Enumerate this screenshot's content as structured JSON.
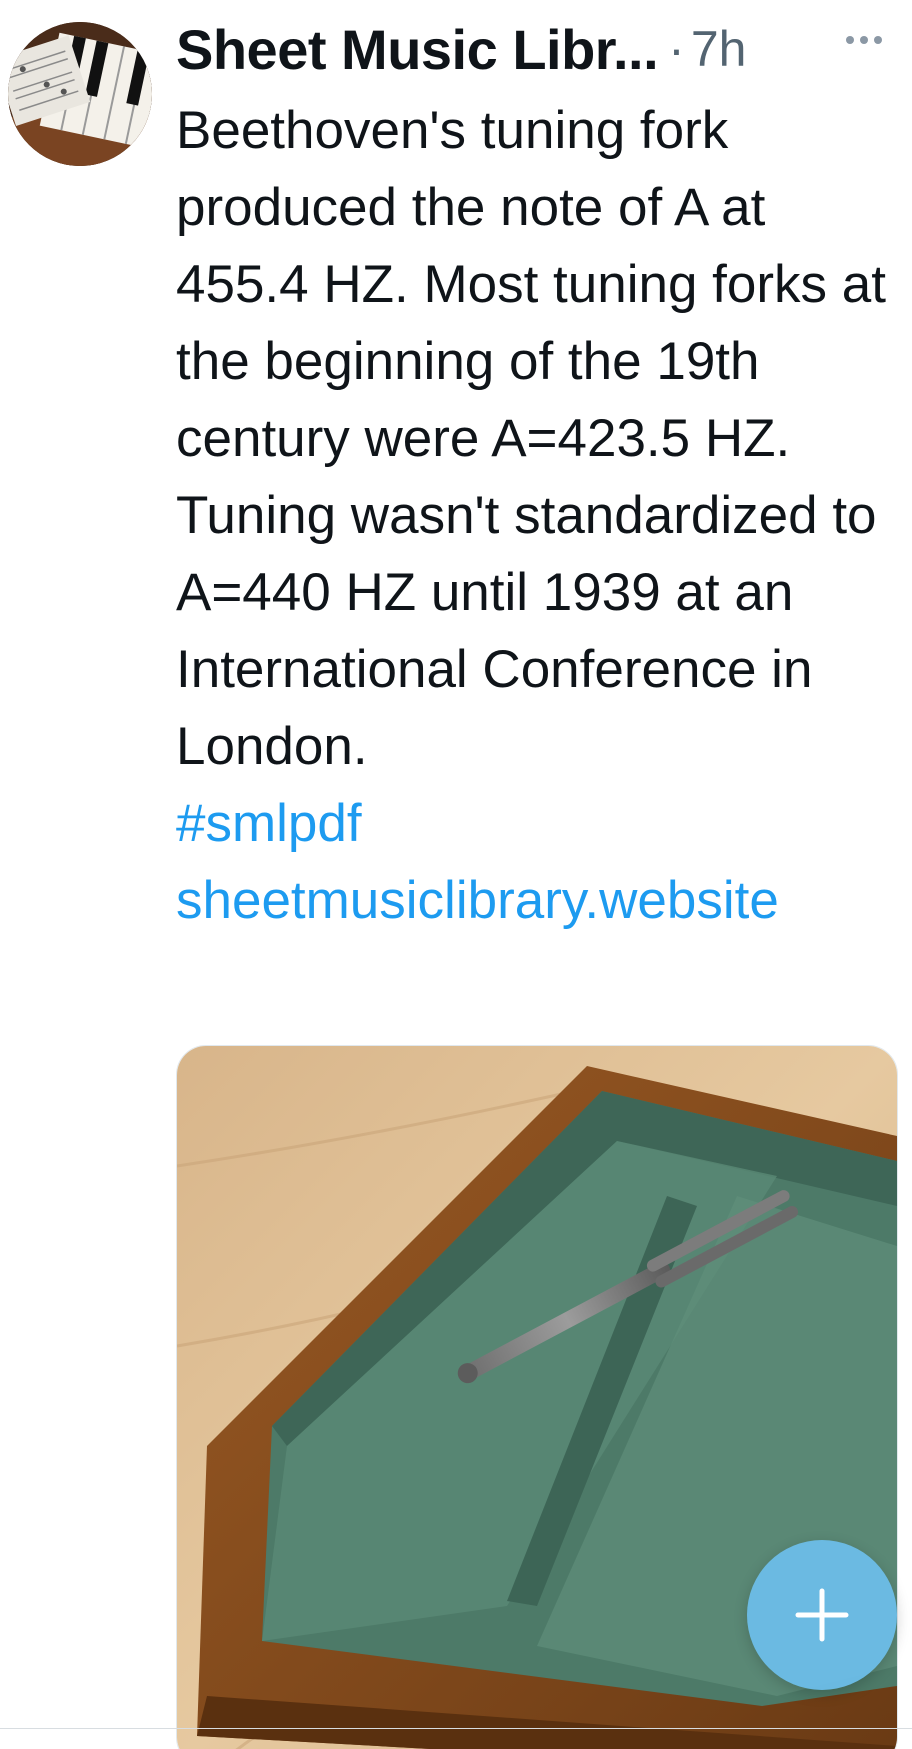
{
  "tweet": {
    "author_name": "Sheet Music Libr...",
    "separator": "·",
    "timestamp": "7h",
    "body_text": "Beethoven's tuning fork produced the note of A at 455.4 HZ. Most tuning forks at the beginning of the 19th century were A=423.5 HZ. Tuning wasn't standardized to A=440 HZ until 1939 at an International Conference in London.",
    "hashtag": "#smlpdf",
    "link": "sheetmusiclibrary.website"
  },
  "icons": {
    "more": "more-horizontal-icon",
    "compose": "plus-icon"
  },
  "colors": {
    "link": "#1d9bf0",
    "fab": "#6cbeec",
    "secondary_text": "#536471"
  }
}
